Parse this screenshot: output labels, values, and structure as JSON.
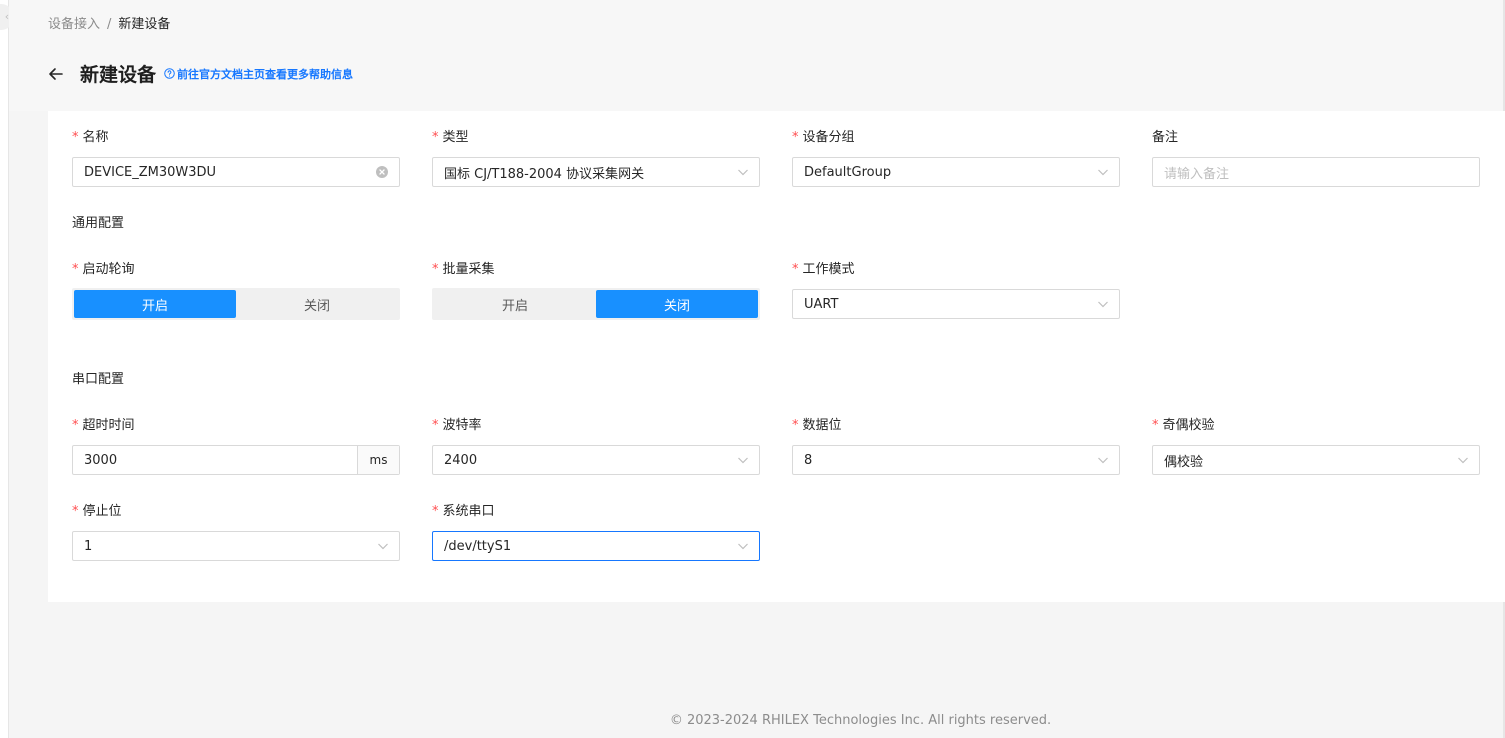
{
  "breadcrumb": {
    "parent": "设备接入",
    "separator": "/",
    "current": "新建设备"
  },
  "header": {
    "title": "新建设备",
    "help_link": "前往官方文档主页查看更多帮助信息"
  },
  "form": {
    "name": {
      "label": "名称",
      "value": "DEVICE_ZM30W3DU"
    },
    "type": {
      "label": "类型",
      "value": "国标 CJ/T188-2004 协议采集网关"
    },
    "group": {
      "label": "设备分组",
      "value": "DefaultGroup"
    },
    "remark": {
      "label": "备注",
      "placeholder": "请输入备注"
    },
    "common_section": "通用配置",
    "polling": {
      "label": "启动轮询",
      "on": "开启",
      "off": "关闭",
      "selected": "on"
    },
    "batch": {
      "label": "批量采集",
      "on": "开启",
      "off": "关闭",
      "selected": "off"
    },
    "work_mode": {
      "label": "工作模式",
      "value": "UART"
    },
    "serial_section": "串口配置",
    "timeout": {
      "label": "超时时间",
      "value": "3000",
      "unit": "ms"
    },
    "baud_rate": {
      "label": "波特率",
      "value": "2400"
    },
    "data_bits": {
      "label": "数据位",
      "value": "8"
    },
    "parity": {
      "label": "奇偶校验",
      "value": "偶校验"
    },
    "stop_bits": {
      "label": "停止位",
      "value": "1"
    },
    "serial_port": {
      "label": "系统串口",
      "value": "/dev/ttyS1"
    }
  },
  "footer": {
    "copyright": "2023-2024 RHILEX Technologies Inc. All rights reserved."
  },
  "colors": {
    "primary": "#1890ff",
    "required": "#ff4d4f",
    "link": "#1677ff"
  },
  "icons": {
    "back": "arrow-left-icon",
    "help": "question-circle-icon",
    "clear": "close-circle-icon",
    "dropdown": "chevron-down-icon",
    "copyright": "copyright-icon"
  }
}
